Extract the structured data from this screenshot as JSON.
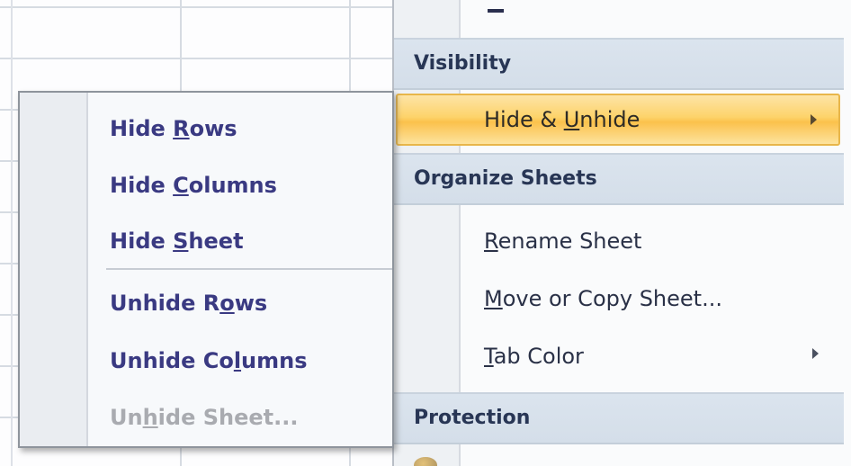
{
  "main_menu": {
    "sections": [
      {
        "header": "Visibility"
      },
      {
        "header": "Organize Sheets"
      },
      {
        "header": "Protection"
      }
    ],
    "hide_unhide": {
      "pre": "Hide & ",
      "u": "U",
      "post": "nhide"
    },
    "rename_sheet": {
      "pre": "",
      "u": "R",
      "post": "ename Sheet"
    },
    "move_copy": {
      "pre": "",
      "u": "M",
      "post": "ove or Copy Sheet..."
    },
    "tab_color": {
      "pre": "",
      "u": "T",
      "post": "ab Color"
    }
  },
  "submenu": {
    "hide_rows": {
      "pre": "Hide ",
      "u": "R",
      "post": "ows"
    },
    "hide_columns": {
      "pre": "Hide ",
      "u": "C",
      "post": "olumns"
    },
    "hide_sheet": {
      "pre": "Hide ",
      "u": "S",
      "post": "heet"
    },
    "unhide_rows": {
      "pre": "Unhide R",
      "u": "o",
      "post": "ws"
    },
    "unhide_columns": {
      "pre": "Unhide Co",
      "u": "l",
      "post": "umns"
    },
    "unhide_sheet": {
      "pre": "Un",
      "u": "h",
      "post": "ide Sheet..."
    }
  },
  "colors": {
    "highlight": "#fdd36a",
    "section_header": "#d4dee9",
    "submenu_text": "#3a3a82",
    "disabled_text": "#a9abb0"
  }
}
